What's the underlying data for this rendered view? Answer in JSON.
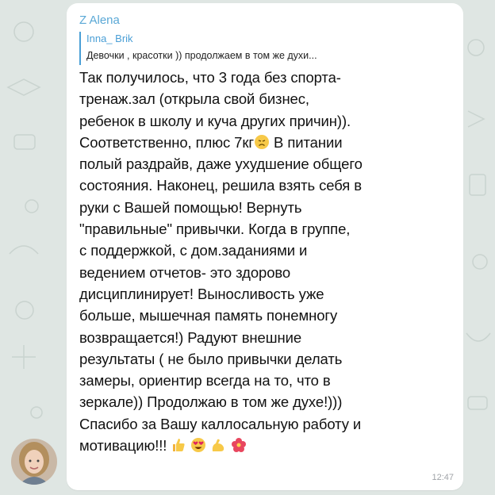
{
  "message": {
    "sender": "Z Alena",
    "reply": {
      "author": "Inna_ Brik",
      "text": "Девочки , красотки )) продолжаем в том же духи..."
    },
    "part1": "Так получилось, что 3 года без спорта-\nтренаж.зал (открыла свой бизнес,\nребенок в школу и куча других причин)).\nСоответственно, плюс 7кг",
    "part2": " В питании",
    "part3": "полый раздрайв, даже ухудшение общего\nсостояния. Наконец, решила взять себя в\nруки с Вашей помощью! Вернуть\n\"правильные\" привычки. Когда в группе,\nс поддержкой, с дом.заданиями и\nведением отчетов- это здорово\nдисциплинирует! Выносливость уже\nбольше, мышечная память понемногу\nвозвращается!) Радуют внешние\nрезультаты ( не было привычки делать\nзамеры, ориентир всегда на то, что в\nзеркале)) Продолжаю в том же духе!)))\nСпасибо за Вашу каллосальную работу и\nмотивацию!!!",
    "time": "12:47",
    "emojis": [
      "disappointed-face",
      "thumbs-up",
      "heart-eyes-face",
      "flexed-biceps",
      "hibiscus-flower"
    ]
  },
  "colors": {
    "background": "#dfe6e3",
    "bubble": "#ffffff",
    "sender": "#5aa8d6",
    "reply_accent": "#4a9fd6",
    "time": "#a0a4a8"
  }
}
